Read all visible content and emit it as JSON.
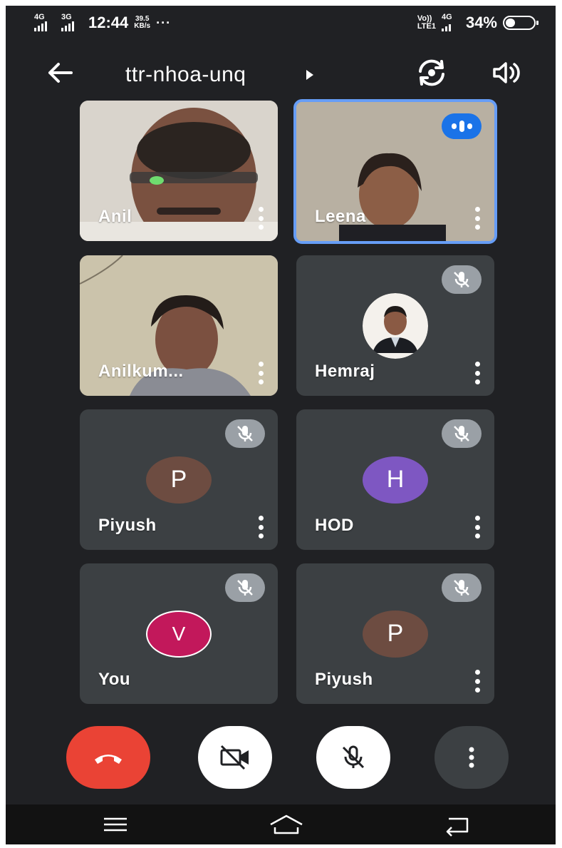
{
  "status_bar": {
    "net1": "4G",
    "net2": "3G",
    "time": "12:44",
    "speed_value": "39.5",
    "speed_unit": "KB/s",
    "dots": "···",
    "volte_top": "Vo))",
    "volte_bottom": "LTE1",
    "net3": "4G",
    "battery": "34%",
    "battery_level": 0.34
  },
  "app_bar": {
    "meeting_code": "ttr-nhoa-unq"
  },
  "participants": [
    {
      "name": "Anil",
      "type": "camera",
      "speaking": false,
      "muted": false
    },
    {
      "name": "Leena",
      "type": "camera",
      "speaking": true,
      "muted": false
    },
    {
      "name": "Anilkum...",
      "type": "camera",
      "speaking": false,
      "muted": false
    },
    {
      "name": "Hemraj",
      "type": "photo",
      "speaking": false,
      "muted": true
    },
    {
      "name": "Piyush",
      "initial": "P",
      "avatar_color": "#6d4c41",
      "muted": true
    },
    {
      "name": "HOD",
      "initial": "H",
      "avatar_color": "#7e57c2",
      "muted": true
    },
    {
      "name": "You",
      "initial": "V",
      "avatar_color": "#c2185b",
      "muted": true
    },
    {
      "name": "Piyush",
      "initial": "P",
      "avatar_color": "#6d4c41",
      "muted": true
    }
  ],
  "colors": {
    "background": "#202124",
    "tile": "#3c4043",
    "end_call": "#ea4335",
    "speaking_border": "#669df6",
    "speaking_badge": "#1a73e8"
  },
  "icons": {
    "back": "arrow-left-icon",
    "switch_camera": "switch-camera-icon",
    "speaker": "speaker-icon",
    "mute": "mic-off-icon",
    "end_call": "phone-hangup-icon",
    "camera_off": "video-off-icon",
    "more": "more-vert-icon",
    "nav_menu": "menu-icon",
    "nav_home": "home-icon",
    "nav_back": "nav-back-icon"
  }
}
